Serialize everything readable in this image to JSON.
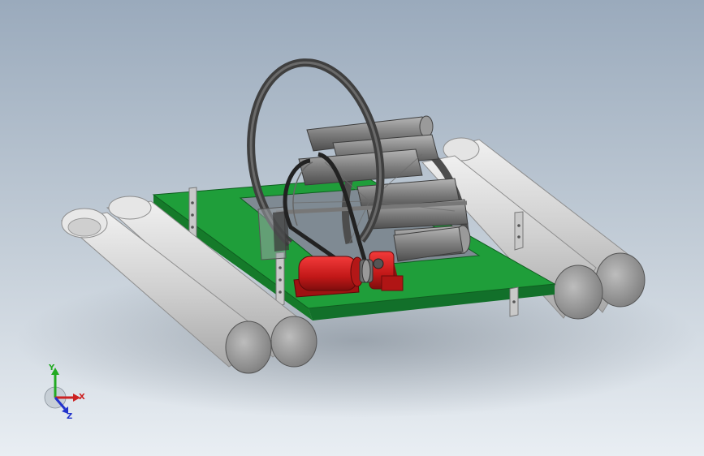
{
  "triad": {
    "x_label": "X",
    "y_label": "Y",
    "z_label": "Z",
    "x_color": "#cc2222",
    "y_color": "#22aa22",
    "z_color": "#2233cc"
  },
  "colors": {
    "background_top": "#9aaabc",
    "background_bottom": "#e9eef3",
    "deck": "#1f9e3a",
    "deck_edge": "#157a2a",
    "float": "#d4d4d4",
    "float_end": "#9a9a9a",
    "motor": "#d41f1f",
    "wheel_frame": "#555555",
    "paddle": "#8a8a8a",
    "bracket": "#b0b0b0"
  },
  "components": [
    {
      "name": "deck-plate"
    },
    {
      "name": "float-left-front"
    },
    {
      "name": "float-left-rear"
    },
    {
      "name": "float-right-front"
    },
    {
      "name": "float-right-rear"
    },
    {
      "name": "paddle-wheel"
    },
    {
      "name": "drive-belt"
    },
    {
      "name": "motor"
    },
    {
      "name": "bearing-block"
    }
  ]
}
